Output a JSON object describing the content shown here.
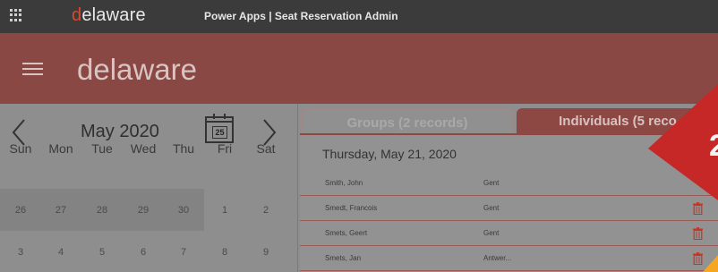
{
  "topbar": {
    "logo_d": "d",
    "logo_rest": "elaware",
    "app_title": "Power Apps  |  Seat Reservation Admin"
  },
  "header": {
    "brand": "delaware"
  },
  "calendar": {
    "month_label": "May 2020",
    "icon_day": "25",
    "prev_icon": "chevron-left-icon",
    "next_icon": "chevron-right-icon",
    "weekdays": [
      "Sun",
      "Mon",
      "Tue",
      "Wed",
      "Thu",
      "Fri",
      "Sat"
    ],
    "weeks": [
      [
        "26",
        "27",
        "28",
        "29",
        "30",
        "1",
        "2"
      ],
      [
        "3",
        "4",
        "5",
        "6",
        "7",
        "8",
        "9"
      ]
    ]
  },
  "tabs": {
    "groups": "Groups (2 records)",
    "individuals": "Individuals (5 reco"
  },
  "panel": {
    "date": "Thursday, May 21, 2020",
    "rows": [
      {
        "name": "Smith, John",
        "location": "Gent"
      },
      {
        "name": "Smedt, Francois",
        "location": "Gent"
      },
      {
        "name": "Smets, Geert",
        "location": "Gent"
      },
      {
        "name": "Smets, Jan",
        "location": "Antwer..."
      }
    ]
  },
  "badge": {
    "text": "2"
  },
  "colors": {
    "accent": "#8d4843",
    "badge": "#c62828",
    "badge_secondary": "#f5a623",
    "trash": "#c0392b"
  }
}
